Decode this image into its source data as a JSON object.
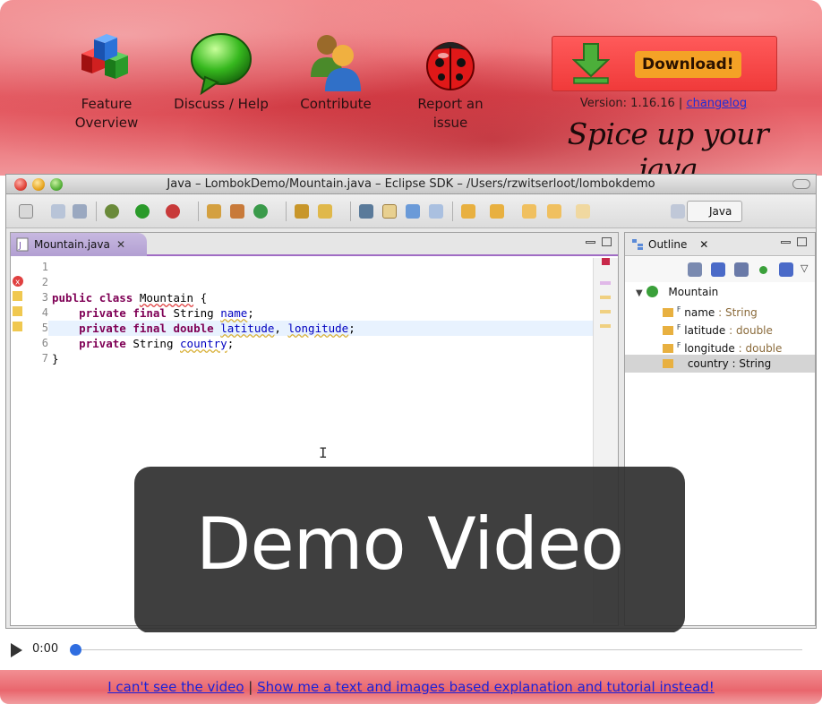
{
  "nav": [
    {
      "label": "Feature Overview",
      "icon": "cubes-icon"
    },
    {
      "label": "Discuss / Help",
      "icon": "speech-bubble-icon"
    },
    {
      "label": "Contribute",
      "icon": "people-icon"
    },
    {
      "label": "Report an issue",
      "icon": "ladybug-icon"
    }
  ],
  "download": {
    "label": "Download!"
  },
  "version": {
    "prefix": "Version: 1.16.16 |",
    "changelog": "changelog"
  },
  "tagline": "Spice up your java",
  "eclipse": {
    "title": "Java – LombokDemo/Mountain.java – Eclipse SDK – /Users/rzwitserloot/lombokdemo",
    "perspective": "Java",
    "editor_tab": "Mountain.java",
    "line_numbers": [
      "1",
      "2",
      "3",
      "4",
      "5",
      "6",
      "7"
    ],
    "outline_tab": "Outline",
    "outline": {
      "root": "Mountain",
      "fields": [
        {
          "name": "name",
          "type": ": String"
        },
        {
          "name": "latitude",
          "type": ": double"
        },
        {
          "name": "longitude",
          "type": ": double"
        },
        {
          "name": "country",
          "type": ": String"
        }
      ]
    }
  },
  "demo": {
    "label": "Demo Video"
  },
  "player": {
    "time": "0:00",
    "progress": 0
  },
  "footer": {
    "link1": "I can't see the video",
    "sep": "|",
    "link2": "Show me a text and images based explanation and tutorial instead!"
  },
  "colors": {
    "download_bg": "#f03a3a",
    "download_label": "#f4a226",
    "link": "#1a22d8",
    "knob": "#2f6de0"
  }
}
